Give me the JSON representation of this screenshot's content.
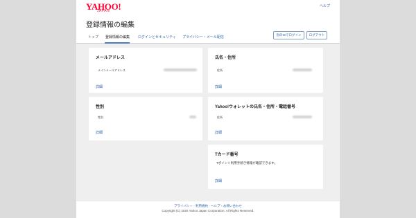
{
  "header": {
    "logo_text": "YAHOO!",
    "logo_sub": "JAPAN",
    "help_link": "ヘルプ",
    "page_title": "登録情報の編集"
  },
  "tabs": [
    {
      "label": "トップ"
    },
    {
      "label": "登録情報の編集"
    },
    {
      "label": "ログインとセキュリティ"
    },
    {
      "label": "プライバシー・メール配信"
    }
  ],
  "buttons": {
    "other_login": "別のIDでログイン",
    "logout": "ログアウト"
  },
  "cards": {
    "email": {
      "title": "メールアドレス",
      "field_label": "メインメールアドレス",
      "detail": "詳細"
    },
    "name_address": {
      "title": "氏名・住所",
      "field_label": "住所",
      "detail": "詳細"
    },
    "gender": {
      "title": "性別",
      "field_label": "性別",
      "detail": "詳細"
    },
    "wallet": {
      "title": "Yahoo!ウォレットの氏名・住所・電話番号",
      "field_label": "住所",
      "detail": "詳細"
    },
    "tcard": {
      "title": "Tカード番号",
      "note": "Tポイント利用手続き情報が確認できます。",
      "detail": "詳細"
    }
  },
  "footer": {
    "links": "プライバシー - 利用規約 - ヘルプ・お問い合わせ",
    "copyright": "Copyright (C) 2020 Yahoo Japan Corporation. All Rights Reserved."
  }
}
